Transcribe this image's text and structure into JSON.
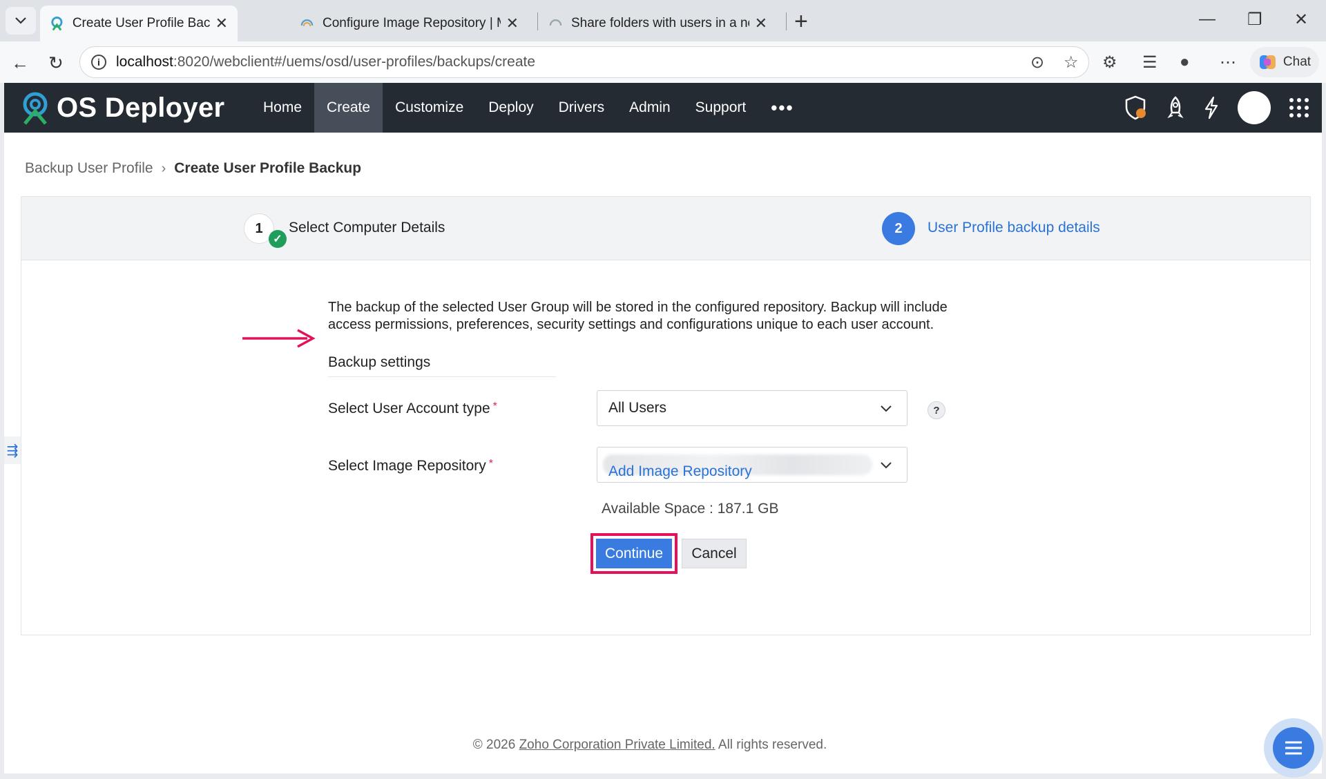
{
  "browser": {
    "tabs": [
      {
        "title": "Create User Profile Backup | Backu",
        "active": true
      },
      {
        "title": "Configure Image Repository | Man",
        "active": false
      },
      {
        "title": "Share folders with users in a netwo",
        "active": false
      }
    ],
    "url_host": "localhost",
    "url_path": ":8020/webclient#/uems/osd/user-profiles/backups/create",
    "chat_label": "Chat"
  },
  "app": {
    "name": "OS Deployer",
    "nav": [
      {
        "label": "Home",
        "active": false
      },
      {
        "label": "Create",
        "active": true
      },
      {
        "label": "Customize",
        "active": false
      },
      {
        "label": "Deploy",
        "active": false
      },
      {
        "label": "Drivers",
        "active": false
      },
      {
        "label": "Admin",
        "active": false
      },
      {
        "label": "Support",
        "active": false
      }
    ]
  },
  "breadcrumb": {
    "parent": "Backup User Profile",
    "current": "Create User Profile Backup"
  },
  "wizard": {
    "step1": {
      "number": "1",
      "label": "Select Computer Details",
      "complete": true
    },
    "step2": {
      "number": "2",
      "label": "User Profile backup details",
      "active": true
    }
  },
  "form": {
    "description": "The backup of the selected User Group will be stored in the configured repository. Backup will include access permissions, preferences, security settings and configurations unique to each user account.",
    "section_title": "Backup settings",
    "account_type_label": "Select User Account type",
    "account_type_value": "All Users",
    "repository_label": "Select Image Repository",
    "required_mark": "*",
    "help_mark": "?",
    "add_repository_link": "Add Image Repository",
    "available_space": "Available Space : 187.1 GB",
    "continue_label": "Continue",
    "cancel_label": "Cancel"
  },
  "footer": {
    "prefix": "© 2026 ",
    "company": "Zoho Corporation Private Limited.",
    "suffix": " All rights reserved."
  },
  "colors": {
    "header_bg": "#252b33",
    "accent": "#3a7be2",
    "highlight": "#e5105a",
    "success": "#1e9e5a"
  }
}
